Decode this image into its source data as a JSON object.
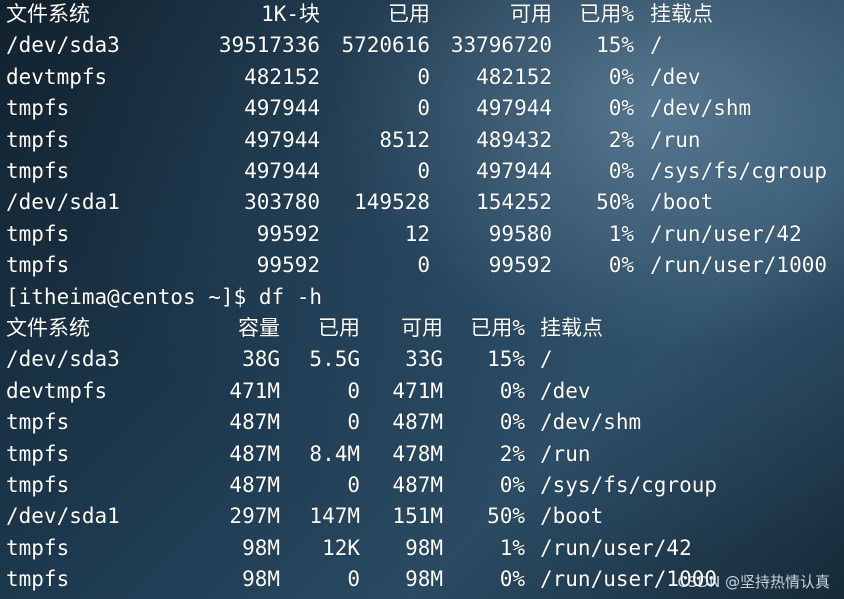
{
  "terminal": {
    "df_kb": {
      "headers": {
        "filesystem": "文件系统",
        "size": "1K-块",
        "used": "已用",
        "avail": "可用",
        "use_pct": "已用%",
        "mount": "挂载点"
      },
      "rows": [
        {
          "filesystem": "/dev/sda3",
          "size": "39517336",
          "used": "5720616",
          "avail": "33796720",
          "use_pct": "15%",
          "mount": "/"
        },
        {
          "filesystem": "devtmpfs",
          "size": "482152",
          "used": "0",
          "avail": "482152",
          "use_pct": "0%",
          "mount": "/dev"
        },
        {
          "filesystem": "tmpfs",
          "size": "497944",
          "used": "0",
          "avail": "497944",
          "use_pct": "0%",
          "mount": "/dev/shm"
        },
        {
          "filesystem": "tmpfs",
          "size": "497944",
          "used": "8512",
          "avail": "489432",
          "use_pct": "2%",
          "mount": "/run"
        },
        {
          "filesystem": "tmpfs",
          "size": "497944",
          "used": "0",
          "avail": "497944",
          "use_pct": "0%",
          "mount": "/sys/fs/cgroup"
        },
        {
          "filesystem": "/dev/sda1",
          "size": "303780",
          "used": "149528",
          "avail": "154252",
          "use_pct": "50%",
          "mount": "/boot"
        },
        {
          "filesystem": "tmpfs",
          "size": "99592",
          "used": "12",
          "avail": "99580",
          "use_pct": "1%",
          "mount": "/run/user/42"
        },
        {
          "filesystem": "tmpfs",
          "size": "99592",
          "used": "0",
          "avail": "99592",
          "use_pct": "0%",
          "mount": "/run/user/1000"
        }
      ]
    },
    "prompt": "[itheima@centos ~]$ df -h",
    "df_h": {
      "headers": {
        "filesystem": "文件系统",
        "size": "容量",
        "used": "已用",
        "avail": "可用",
        "use_pct": "已用%",
        "mount": "挂载点"
      },
      "rows": [
        {
          "filesystem": "/dev/sda3",
          "size": "38G",
          "used": "5.5G",
          "avail": "33G",
          "use_pct": "15%",
          "mount": "/"
        },
        {
          "filesystem": "devtmpfs",
          "size": "471M",
          "used": "0",
          "avail": "471M",
          "use_pct": "0%",
          "mount": "/dev"
        },
        {
          "filesystem": "tmpfs",
          "size": "487M",
          "used": "0",
          "avail": "487M",
          "use_pct": "0%",
          "mount": "/dev/shm"
        },
        {
          "filesystem": "tmpfs",
          "size": "487M",
          "used": "8.4M",
          "avail": "478M",
          "use_pct": "2%",
          "mount": "/run"
        },
        {
          "filesystem": "tmpfs",
          "size": "487M",
          "used": "0",
          "avail": "487M",
          "use_pct": "0%",
          "mount": "/sys/fs/cgroup"
        },
        {
          "filesystem": "/dev/sda1",
          "size": "297M",
          "used": "147M",
          "avail": "151M",
          "use_pct": "50%",
          "mount": "/boot"
        },
        {
          "filesystem": "tmpfs",
          "size": "98M",
          "used": "12K",
          "avail": "98M",
          "use_pct": "1%",
          "mount": "/run/user/42"
        },
        {
          "filesystem": "tmpfs",
          "size": "98M",
          "used": "0",
          "avail": "98M",
          "use_pct": "0%",
          "mount": "/run/user/1000"
        }
      ]
    }
  },
  "watermark": "CSDN @坚持热情认真"
}
